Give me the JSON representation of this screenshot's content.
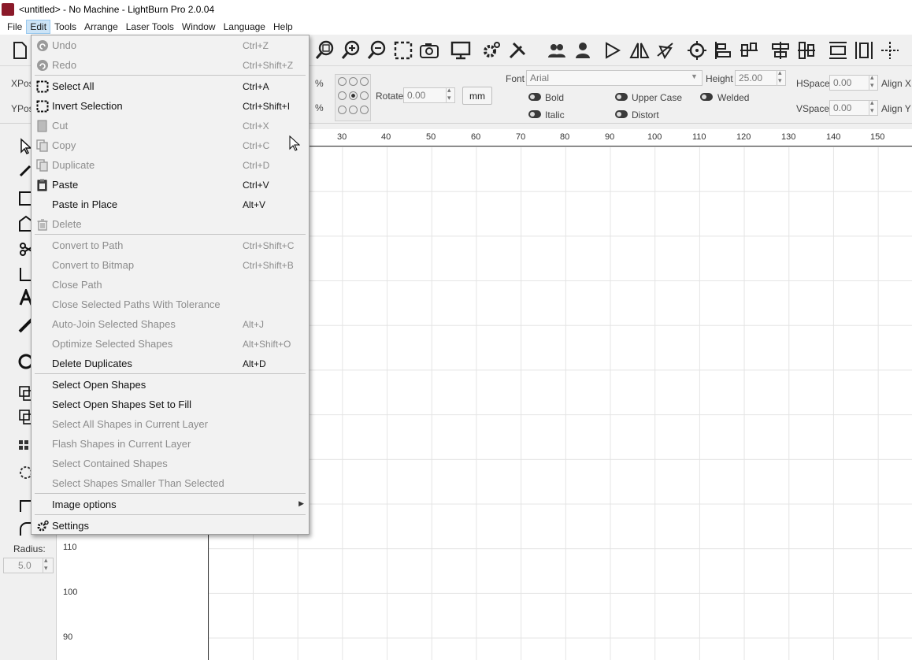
{
  "window": {
    "title": "<untitled> - No Machine - LightBurn Pro 2.0.04"
  },
  "menubar": {
    "items": [
      {
        "label": "File"
      },
      {
        "label": "Edit"
      },
      {
        "label": "Tools"
      },
      {
        "label": "Arrange"
      },
      {
        "label": "Laser Tools"
      },
      {
        "label": "Window"
      },
      {
        "label": "Language"
      },
      {
        "label": "Help"
      }
    ]
  },
  "propbar": {
    "xpos_label": "XPos",
    "ypos_label": "YPos",
    "pct1": "%",
    "pct2": "%",
    "rotate_label": "Rotate",
    "rotate_value": "0.00",
    "units_button": "mm",
    "font_label": "Font",
    "font_value": "Arial",
    "height_label": "Height",
    "height_value": "25.00",
    "hspace_label": "HSpace",
    "hspace_value": "0.00",
    "vspace_label": "VSpace",
    "vspace_value": "0.00",
    "alignx_label": "Align X",
    "aligny_label": "Align Y",
    "bold": "Bold",
    "italic": "Italic",
    "upper_case": "Upper Case",
    "distort": "Distort",
    "welded": "Welded"
  },
  "ruler": {
    "h_ticks": [
      "30",
      "40",
      "50",
      "60",
      "70",
      "80",
      "90",
      "100",
      "110",
      "120",
      "130",
      "140",
      "150"
    ],
    "v_ticks": [
      "110",
      "100",
      "90"
    ]
  },
  "left": {
    "radius_label": "Radius:",
    "radius_value": "5.0"
  },
  "edit_menu": {
    "items": [
      {
        "label": "Undo",
        "shortcut": "Ctrl+Z",
        "enabled": false,
        "icon": "undo-icon"
      },
      {
        "label": "Redo",
        "shortcut": "Ctrl+Shift+Z",
        "enabled": false,
        "icon": "redo-icon"
      },
      {
        "label": "Select All",
        "shortcut": "Ctrl+A",
        "enabled": true,
        "icon": "select-all-icon"
      },
      {
        "label": "Invert Selection",
        "shortcut": "Ctrl+Shift+I",
        "enabled": true,
        "icon": "invert-selection-icon"
      },
      {
        "label": "Cut",
        "shortcut": "Ctrl+X",
        "enabled": false,
        "icon": "cut-icon"
      },
      {
        "label": "Copy",
        "shortcut": "Ctrl+C",
        "enabled": false,
        "icon": "copy-icon"
      },
      {
        "label": "Duplicate",
        "shortcut": "Ctrl+D",
        "enabled": false,
        "icon": "duplicate-icon"
      },
      {
        "label": "Paste",
        "shortcut": "Ctrl+V",
        "enabled": true,
        "icon": "paste-icon"
      },
      {
        "label": "Paste in Place",
        "shortcut": "Alt+V",
        "enabled": true,
        "icon": ""
      },
      {
        "label": "Delete",
        "shortcut": "",
        "enabled": false,
        "icon": "trash-icon"
      },
      {
        "label": "Convert to Path",
        "shortcut": "Ctrl+Shift+C",
        "enabled": false,
        "icon": ""
      },
      {
        "label": "Convert to Bitmap",
        "shortcut": "Ctrl+Shift+B",
        "enabled": false,
        "icon": ""
      },
      {
        "label": "Close Path",
        "shortcut": "",
        "enabled": false,
        "icon": ""
      },
      {
        "label": "Close Selected Paths With Tolerance",
        "shortcut": "",
        "enabled": false,
        "icon": ""
      },
      {
        "label": "Auto-Join Selected Shapes",
        "shortcut": "Alt+J",
        "enabled": false,
        "icon": ""
      },
      {
        "label": "Optimize Selected Shapes",
        "shortcut": "Alt+Shift+O",
        "enabled": false,
        "icon": ""
      },
      {
        "label": "Delete Duplicates",
        "shortcut": "Alt+D",
        "enabled": true,
        "icon": ""
      },
      {
        "label": "Select Open Shapes",
        "shortcut": "",
        "enabled": true,
        "icon": ""
      },
      {
        "label": "Select Open Shapes Set to Fill",
        "shortcut": "",
        "enabled": true,
        "icon": ""
      },
      {
        "label": "Select All Shapes in Current Layer",
        "shortcut": "",
        "enabled": false,
        "icon": ""
      },
      {
        "label": "Flash Shapes in Current Layer",
        "shortcut": "",
        "enabled": false,
        "icon": ""
      },
      {
        "label": "Select Contained Shapes",
        "shortcut": "",
        "enabled": false,
        "icon": ""
      },
      {
        "label": "Select Shapes Smaller Than Selected",
        "shortcut": "",
        "enabled": false,
        "icon": ""
      },
      {
        "label": "Image options",
        "shortcut": "",
        "enabled": true,
        "icon": "",
        "submenu": true
      },
      {
        "label": "Settings",
        "shortcut": "",
        "enabled": true,
        "icon": "gear-icon"
      }
    ]
  }
}
